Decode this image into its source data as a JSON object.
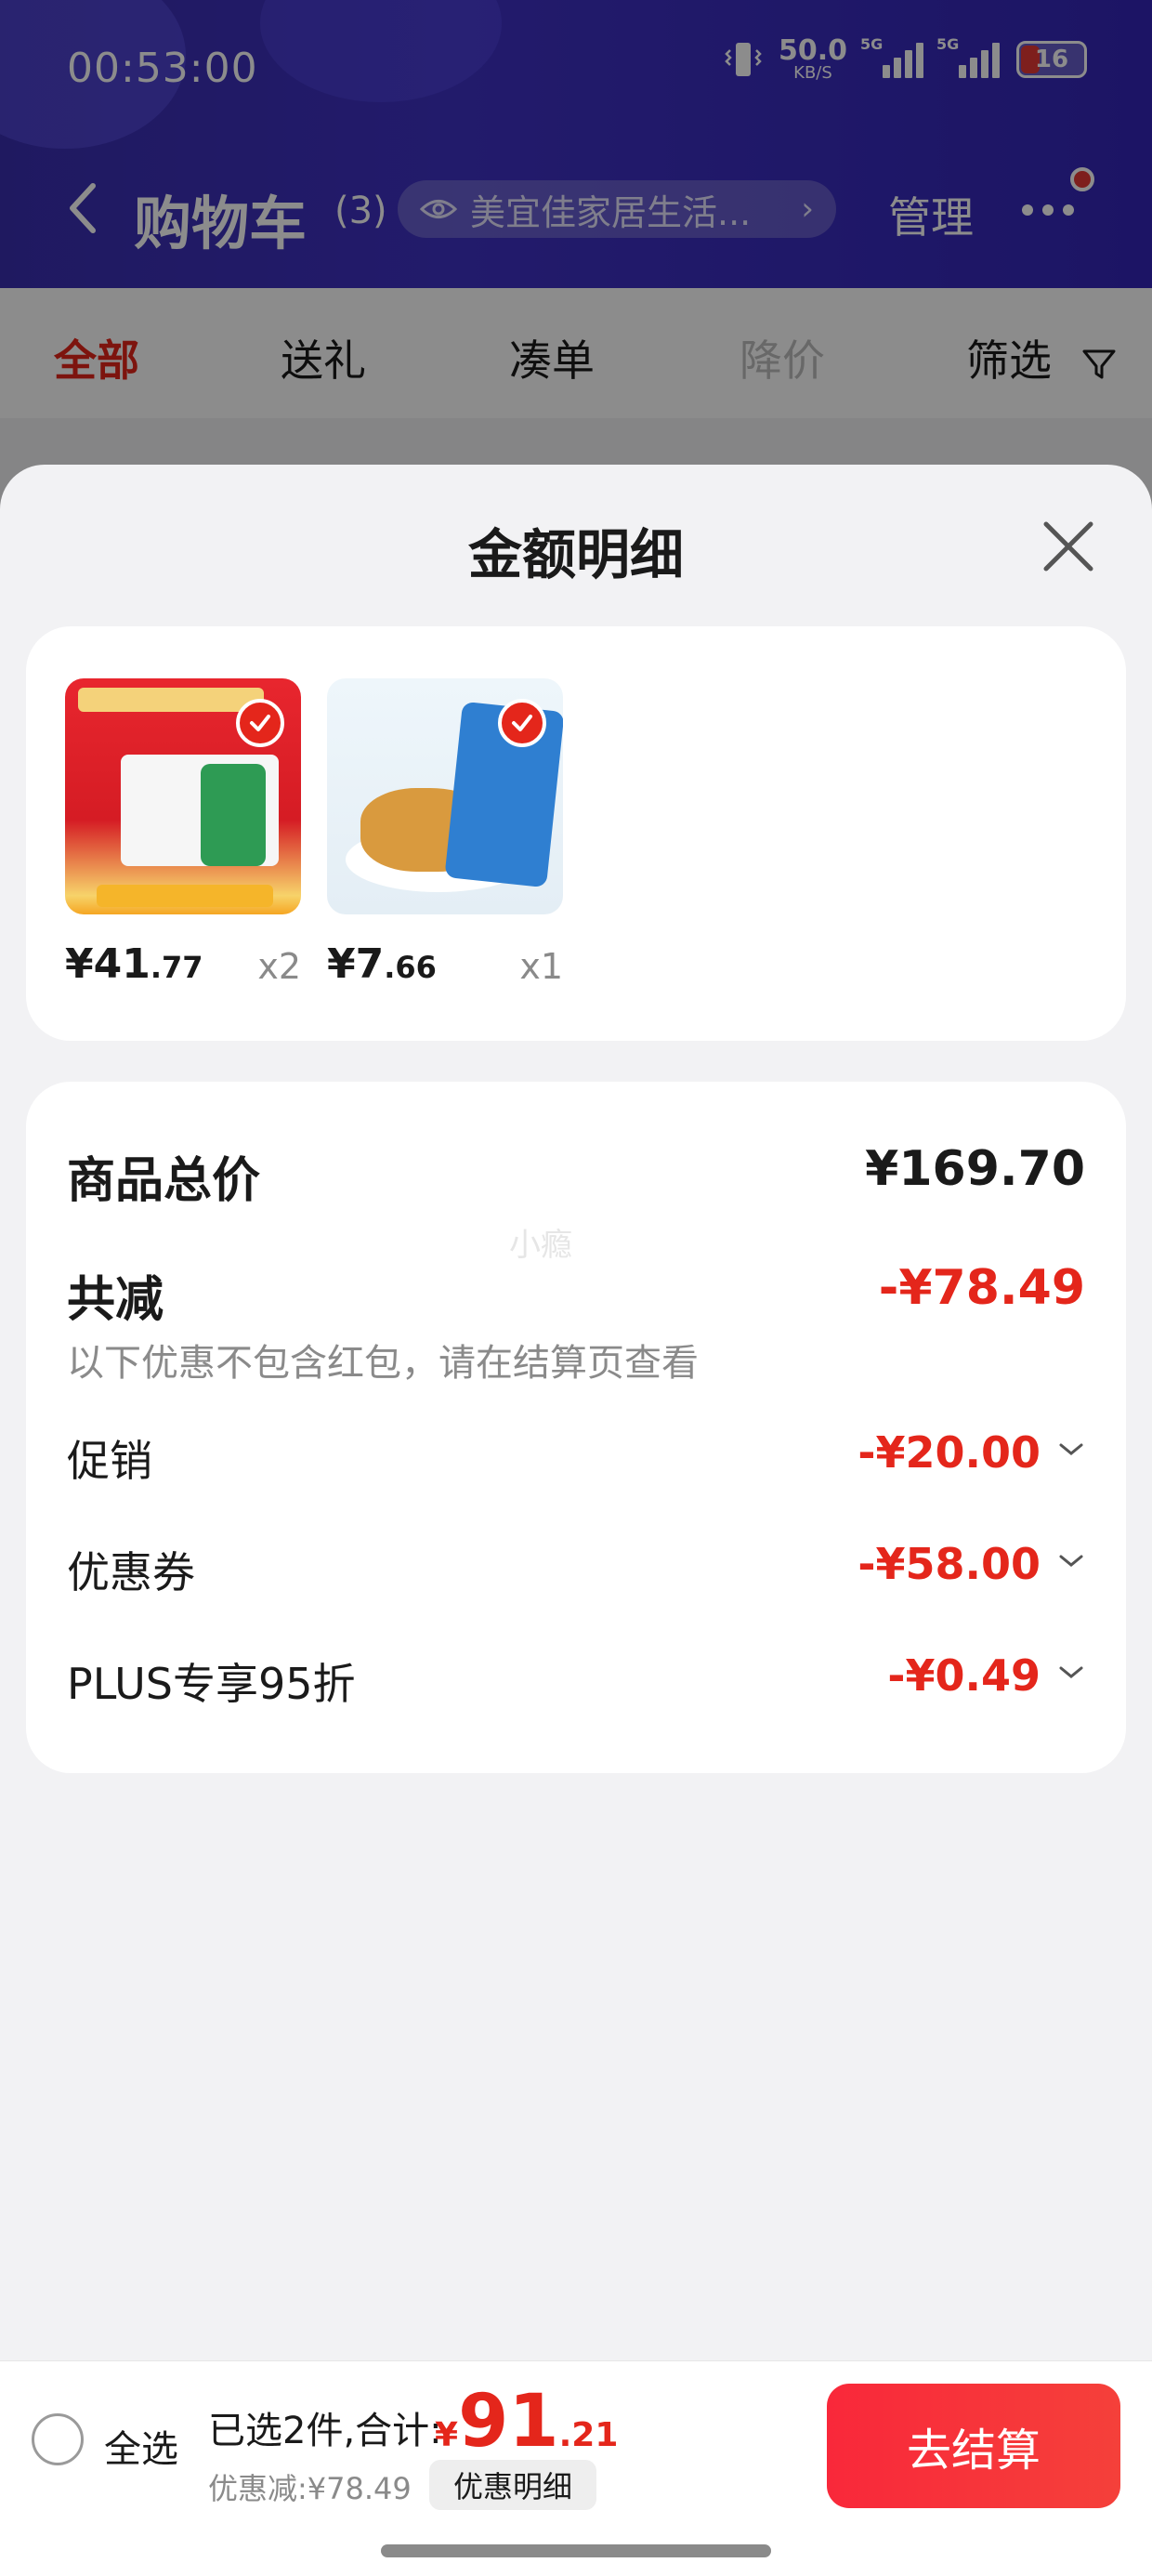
{
  "status_bar": {
    "time": "00:53:00",
    "net_speed": "50.0",
    "net_speed_unit": "KB/S",
    "sim1_type": "5G",
    "sim2_type": "5G",
    "battery": "16"
  },
  "nav": {
    "title": "购物车",
    "count": "(3)",
    "store": "美宜佳家居生活...",
    "manage": "管理"
  },
  "tabs": [
    {
      "label": "全部"
    },
    {
      "label": "送礼"
    },
    {
      "label": "凑单"
    },
    {
      "label": "降价"
    },
    {
      "label": "筛选"
    }
  ],
  "sheet": {
    "title": "金额明细",
    "items": [
      {
        "price_int": "¥41",
        "price_dec": ".77",
        "qty": "x2",
        "selected": true
      },
      {
        "price_int": "¥7",
        "price_dec": ".66",
        "qty": "x1",
        "selected": true
      }
    ],
    "watermark": "小瘾",
    "summary": {
      "subtotal_label": "商品总价",
      "subtotal": "¥169.70",
      "reduction_label": "共减",
      "reduction": "-¥78.49",
      "note": "以下优惠不包含红包，请在结算页查看",
      "lines": [
        {
          "label": "促销",
          "value": "-¥20.00"
        },
        {
          "label": "优惠券",
          "value": "-¥58.00"
        },
        {
          "label": "PLUS专享95折",
          "value": "-¥0.49"
        }
      ]
    }
  },
  "bottom": {
    "select_all": "全选",
    "selected_text": "已选2件,合计:",
    "currency": "¥",
    "total_int": "91",
    "total_dec": ".21",
    "discount_text": "优惠减:¥78.49",
    "detail_button": "优惠明细",
    "checkout": "去结算"
  },
  "colors": {
    "accent": "#e4261b",
    "header": "#3a2fb0",
    "checkout": "#f9283a"
  }
}
